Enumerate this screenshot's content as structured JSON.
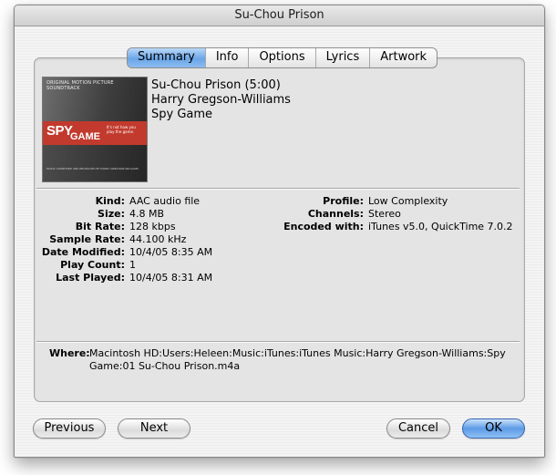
{
  "window": {
    "title": "Su-Chou Prison"
  },
  "tabs": [
    {
      "label": "Summary",
      "active": true
    },
    {
      "label": "Info",
      "active": false
    },
    {
      "label": "Options",
      "active": false
    },
    {
      "label": "Lyrics",
      "active": false
    },
    {
      "label": "Artwork",
      "active": false
    }
  ],
  "artwork": {
    "top_text": "ORIGINAL MOTION PICTURE SOUNDTRACK",
    "title_line1": "SPY",
    "title_line2": "GAME",
    "tagline": "It's not how you play the game.",
    "credits": "MUSIC COMPOSED AND PRODUCED BY HARRY GREGSON-WILLIAMS"
  },
  "track": {
    "name": "Su-Chou Prison (5:00)",
    "artist": "Harry Gregson-Williams",
    "album": "Spy Game"
  },
  "properties_left": [
    {
      "key": "Kind:",
      "value": "AAC audio file"
    },
    {
      "key": "Size:",
      "value": "4.8 MB"
    },
    {
      "key": "Bit Rate:",
      "value": "128 kbps"
    },
    {
      "key": "Sample Rate:",
      "value": "44.100 kHz"
    },
    {
      "key": "Date Modified:",
      "value": "10/4/05 8:35 AM"
    },
    {
      "key": "Play Count:",
      "value": "1"
    },
    {
      "key": "Last Played:",
      "value": "10/4/05 8:31 AM"
    }
  ],
  "properties_right": [
    {
      "key": "Profile:",
      "value": "Low Complexity"
    },
    {
      "key": "Channels:",
      "value": "Stereo"
    },
    {
      "key": "Encoded with:",
      "value": "iTunes v5.0, QuickTime 7.0.2"
    }
  ],
  "where": {
    "key": "Where:",
    "value": "Macintosh HD:Users:Heleen:Music:iTunes:iTunes Music:Harry Gregson-Williams:Spy Game:01 Su-Chou Prison.m4a"
  },
  "buttons": {
    "previous": "Previous",
    "next": "Next",
    "cancel": "Cancel",
    "ok": "OK"
  }
}
